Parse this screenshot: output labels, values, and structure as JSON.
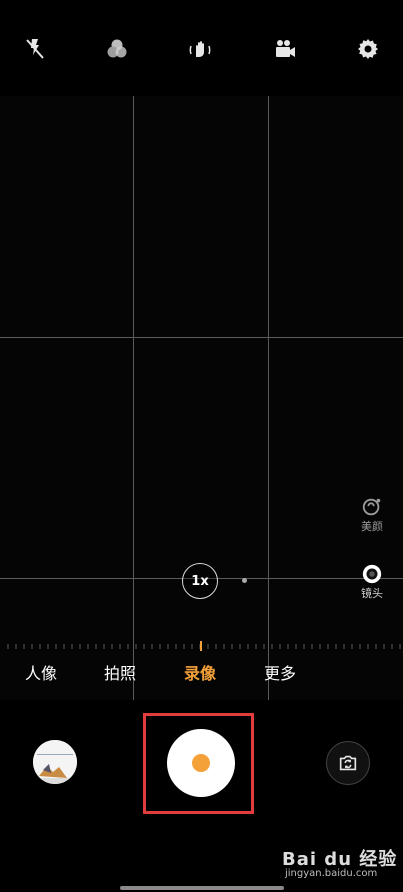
{
  "toolbar": {
    "icons": [
      "flash-off-icon",
      "filter-icon",
      "stabilization-icon",
      "video-format-icon",
      "gear-icon"
    ]
  },
  "side_controls": {
    "beauty_label": "美颜",
    "lens_label": "镜头"
  },
  "zoom": {
    "level": "1x"
  },
  "modes": [
    {
      "label": "人像",
      "active": false
    },
    {
      "label": "拍照",
      "active": false
    },
    {
      "label": "录像",
      "active": true
    },
    {
      "label": "更多",
      "active": false
    }
  ],
  "colors": {
    "accent": "#f5a13a",
    "highlight_frame": "#e23d3d"
  },
  "watermark": {
    "brand": "Bai du 经验",
    "url": "jingyan.baidu.com"
  }
}
